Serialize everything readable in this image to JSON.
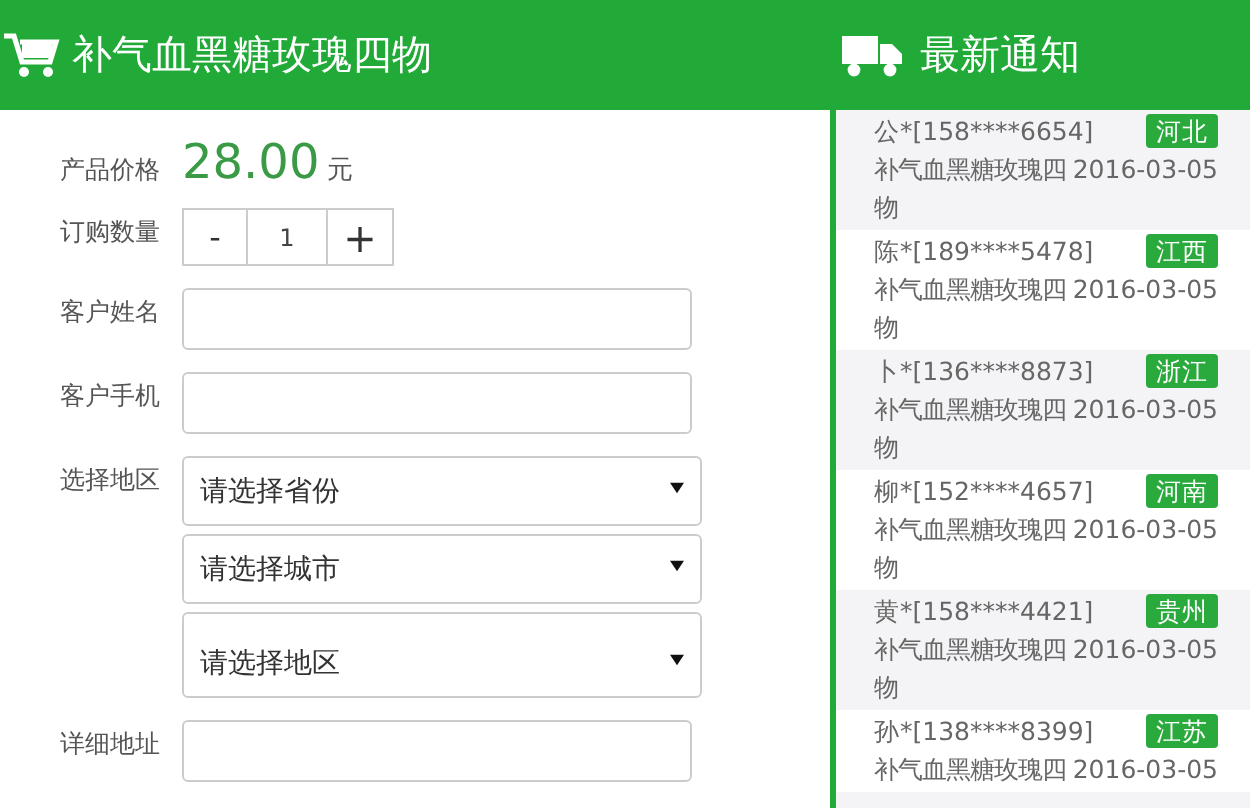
{
  "product": {
    "title": "补气血黑糖玫瑰四物"
  },
  "notices_title": "最新通知",
  "form": {
    "price_label": "产品价格",
    "price": "28.00",
    "price_unit": "元",
    "quantity_label": "订购数量",
    "quantity": {
      "minus": "-",
      "value": "1",
      "plus": "+"
    },
    "name_label": "客户姓名",
    "phone_label": "客户手机",
    "region_label": "选择地区",
    "selects": [
      {
        "value": "请选择省份",
        "kind": "short"
      },
      {
        "value": "请选择城市",
        "kind": "short"
      },
      {
        "value": "请选择地区",
        "kind": "tall"
      }
    ],
    "address_label": "详细地址"
  },
  "notices": [
    {
      "buyer": "公*[158****6654]",
      "region": "河北",
      "product": "补气血黑糖玫瑰四物",
      "date": "2016-03-05"
    },
    {
      "buyer": "陈*[189****5478]",
      "region": "江西",
      "product": "补气血黑糖玫瑰四物",
      "date": "2016-03-05"
    },
    {
      "buyer": "卜*[136****8873]",
      "region": "浙江",
      "product": "补气血黑糖玫瑰四物",
      "date": "2016-03-05"
    },
    {
      "buyer": "柳*[152****4657]",
      "region": "河南",
      "product": "补气血黑糖玫瑰四物",
      "date": "2016-03-05"
    },
    {
      "buyer": "黄*[158****4421]",
      "region": "贵州",
      "product": "补气血黑糖玫瑰四物",
      "date": "2016-03-05"
    },
    {
      "buyer": "孙*[138****8399]",
      "region": "江苏",
      "product": "补气血黑糖玫瑰四",
      "date": "2016-03-05"
    }
  ]
}
